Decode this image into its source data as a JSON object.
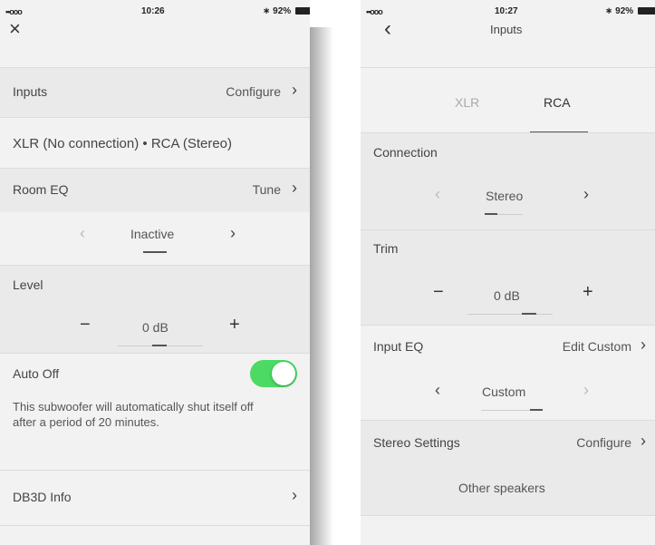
{
  "left": {
    "status": {
      "signal": "••ooo",
      "time": "10:26",
      "battery": "92%"
    },
    "close_icon": "×",
    "inputs": {
      "label": "Inputs",
      "action": "Configure"
    },
    "inputs_summary": "XLR (No connection) • RCA (Stereo)",
    "room_eq": {
      "label": "Room EQ",
      "action": "Tune",
      "value": "Inactive"
    },
    "level": {
      "label": "Level",
      "minus": "−",
      "value": "0 dB",
      "plus": "+"
    },
    "auto_off": {
      "label": "Auto Off",
      "on": true,
      "description": "This subwoofer will automatically shut itself off after a period of 20 minutes."
    },
    "db3d": {
      "label": "DB3D Info"
    }
  },
  "right": {
    "status": {
      "signal": "••ooo",
      "time": "10:27",
      "battery": "92%"
    },
    "nav_title": "Inputs",
    "tabs": [
      "XLR",
      "RCA"
    ],
    "connection": {
      "label": "Connection",
      "value": "Stereo"
    },
    "trim": {
      "label": "Trim",
      "minus": "−",
      "value": "0 dB",
      "plus": "+"
    },
    "input_eq": {
      "label": "Input EQ",
      "action": "Edit Custom",
      "value": "Custom"
    },
    "stereo_settings": {
      "label": "Stereo Settings",
      "action": "Configure",
      "sub": "Other speakers"
    }
  },
  "icons": {
    "chevron_right": "›",
    "chevron_left": "‹",
    "back": "‹",
    "bluetooth": "∗"
  },
  "colors": {
    "toggle_on": "#4cd964",
    "background": "#f2f2f2"
  }
}
